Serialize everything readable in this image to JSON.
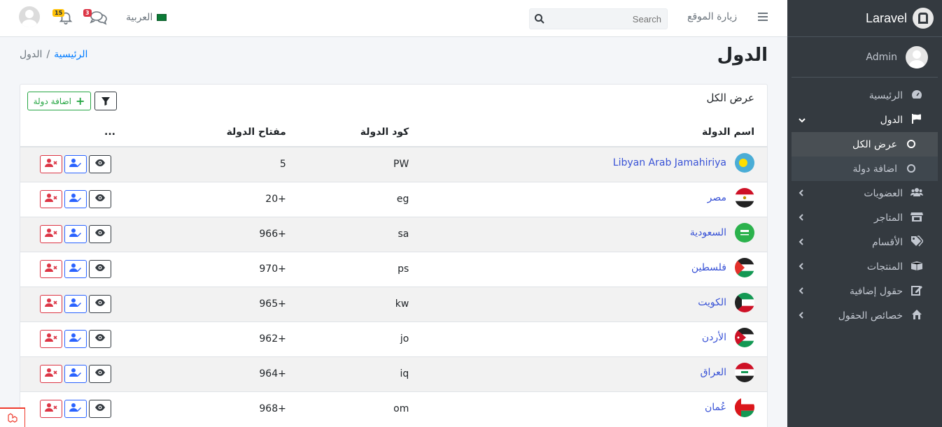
{
  "sidebar": {
    "brand": "Laravel",
    "user": "Admin",
    "items": [
      {
        "label": "الرئيسية",
        "icon": "tachometer-icon"
      },
      {
        "label": "الدول",
        "icon": "flag-icon"
      },
      {
        "label": "العضويات",
        "icon": "users-icon"
      },
      {
        "label": "المتاجر",
        "icon": "store-icon"
      },
      {
        "label": "الأقسام",
        "icon": "tags-icon"
      },
      {
        "label": "المنتجات",
        "icon": "boxes-icon"
      },
      {
        "label": "حقول إضافية",
        "icon": "edit-icon"
      },
      {
        "label": "خصائص الحقول",
        "icon": "house-icon"
      }
    ],
    "subitems": [
      {
        "label": "عرض الكل"
      },
      {
        "label": "اضافة دولة"
      }
    ]
  },
  "navbar": {
    "notifications_count": "15",
    "messages_count": "3",
    "language": "العربية",
    "search_placeholder": "Search",
    "visit_site": "زيارة الموقع"
  },
  "page": {
    "title": "الدول",
    "breadcrumb_home": "الرئيسية",
    "breadcrumb_sep": "/",
    "breadcrumb_current": "الدول"
  },
  "card": {
    "title": "عرض الكل",
    "add_button": "اضافة دولة",
    "columns": [
      "اسم الدولة",
      "كود الدولة",
      "مفتاح الدولة",
      "..."
    ],
    "rows": [
      {
        "name": "Libyan Arab Jamahiriya",
        "code": "PW",
        "key": "5",
        "flag": "palau"
      },
      {
        "name": "مصر",
        "code": "eg",
        "key": "20+",
        "flag": "egypt"
      },
      {
        "name": "السعودية",
        "code": "sa",
        "key": "966+",
        "flag": "saudi"
      },
      {
        "name": "فلسطين",
        "code": "ps",
        "key": "970+",
        "flag": "palestine"
      },
      {
        "name": "الكويت",
        "code": "kw",
        "key": "965+",
        "flag": "kuwait"
      },
      {
        "name": "الأردن",
        "code": "jo",
        "key": "962+",
        "flag": "jordan"
      },
      {
        "name": "العراق",
        "code": "iq",
        "key": "964+",
        "flag": "iraq"
      },
      {
        "name": "عُمان",
        "code": "om",
        "key": "968+",
        "flag": "oman"
      }
    ]
  }
}
